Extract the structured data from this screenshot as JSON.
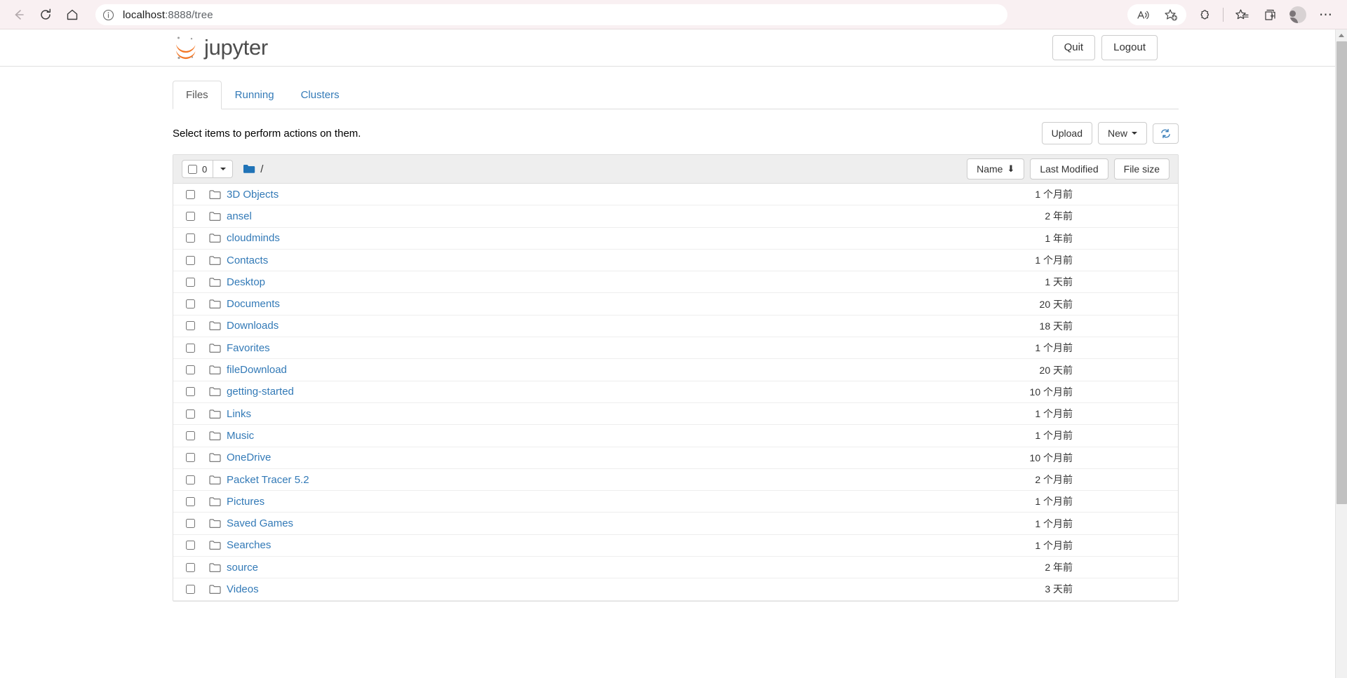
{
  "browser": {
    "url_host": "localhost",
    "url_path": ":8888/tree",
    "back_icon": "back-arrow-icon",
    "reload_icon": "reload-icon",
    "home_icon": "home-icon",
    "info_icon": "info-icon",
    "read_aloud_icon": "read-aloud-icon",
    "add_favorite_icon": "add-to-favorites-icon",
    "extensions_icon": "extensions-puzzle-icon",
    "favorites_icon": "favorites-star-icon",
    "collections_icon": "collections-icon",
    "profile_icon": "profile-avatar-icon",
    "settings_icon": "settings-ellipsis-icon"
  },
  "header": {
    "logo_text": "jupyter",
    "quit_label": "Quit",
    "logout_label": "Logout"
  },
  "tabs": [
    {
      "label": "Files",
      "active": true
    },
    {
      "label": "Running",
      "active": false
    },
    {
      "label": "Clusters",
      "active": false
    }
  ],
  "actionbar": {
    "select_hint": "Select items to perform actions on them.",
    "upload_label": "Upload",
    "new_label": "New",
    "refresh_icon": "refresh-icon"
  },
  "list_header": {
    "selected_count": "0",
    "breadcrumb_path": "/",
    "folder_icon": "folder-filled-icon",
    "sort_name": "Name",
    "sort_name_arrow": "⬇",
    "sort_last_modified": "Last Modified",
    "sort_file_size": "File size"
  },
  "files": [
    {
      "name": "3D Objects",
      "modified": "1 个月前",
      "size": ""
    },
    {
      "name": "ansel",
      "modified": "2 年前",
      "size": ""
    },
    {
      "name": "cloudminds",
      "modified": "1 年前",
      "size": ""
    },
    {
      "name": "Contacts",
      "modified": "1 个月前",
      "size": ""
    },
    {
      "name": "Desktop",
      "modified": "1 天前",
      "size": ""
    },
    {
      "name": "Documents",
      "modified": "20 天前",
      "size": ""
    },
    {
      "name": "Downloads",
      "modified": "18 天前",
      "size": ""
    },
    {
      "name": "Favorites",
      "modified": "1 个月前",
      "size": ""
    },
    {
      "name": "fileDownload",
      "modified": "20 天前",
      "size": ""
    },
    {
      "name": "getting-started",
      "modified": "10 个月前",
      "size": ""
    },
    {
      "name": "Links",
      "modified": "1 个月前",
      "size": ""
    },
    {
      "name": "Music",
      "modified": "1 个月前",
      "size": ""
    },
    {
      "name": "OneDrive",
      "modified": "10 个月前",
      "size": ""
    },
    {
      "name": "Packet Tracer 5.2",
      "modified": "2 个月前",
      "size": ""
    },
    {
      "name": "Pictures",
      "modified": "1 个月前",
      "size": ""
    },
    {
      "name": "Saved Games",
      "modified": "1 个月前",
      "size": ""
    },
    {
      "name": "Searches",
      "modified": "1 个月前",
      "size": ""
    },
    {
      "name": "source",
      "modified": "2 年前",
      "size": ""
    },
    {
      "name": "Videos",
      "modified": "3 天前",
      "size": ""
    }
  ],
  "colors": {
    "link_blue": "#337ab7",
    "jupyter_orange": "#f37726",
    "chrome_bg": "#f9f0f2",
    "header_gray": "#eeeeee"
  }
}
